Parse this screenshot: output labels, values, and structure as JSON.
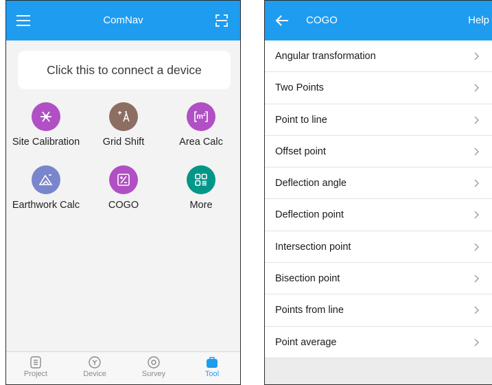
{
  "left": {
    "app_title": "ComNav",
    "connect_prompt": "Click this to connect a device",
    "tools": [
      {
        "label": "Site Calibration",
        "icon": "site-calibration-icon",
        "color": "#b14fc5"
      },
      {
        "label": "Grid Shift",
        "icon": "grid-shift-icon",
        "color": "#8d6e63"
      },
      {
        "label": "Area Calc",
        "icon": "area-calc-icon",
        "color": "#b14fc5"
      },
      {
        "label": "Earthwork Calc",
        "icon": "earthwork-calc-icon",
        "color": "#7986cb"
      },
      {
        "label": "COGO",
        "icon": "cogo-icon",
        "color": "#b14fc5"
      },
      {
        "label": "More",
        "icon": "more-icon",
        "color": "#009688"
      }
    ],
    "area_icon_text": "m²",
    "bottom_nav": [
      {
        "label": "Project",
        "icon": "project-icon",
        "active": false
      },
      {
        "label": "Device",
        "icon": "device-icon",
        "active": false
      },
      {
        "label": "Survey",
        "icon": "survey-icon",
        "active": false
      },
      {
        "label": "Tool",
        "icon": "tool-icon",
        "active": true
      }
    ]
  },
  "right": {
    "title": "COGO",
    "help_label": "Help",
    "items": [
      {
        "label": "Angular transformation"
      },
      {
        "label": "Two Points"
      },
      {
        "label": "Point to line"
      },
      {
        "label": "Offset point"
      },
      {
        "label": "Deflection angle"
      },
      {
        "label": "Deflection point"
      },
      {
        "label": "Intersection point"
      },
      {
        "label": "Bisection point"
      },
      {
        "label": "Points from line"
      },
      {
        "label": "Point average"
      }
    ]
  },
  "colors": {
    "accent": "#1e9cf0",
    "background": "#f3f3f3"
  }
}
